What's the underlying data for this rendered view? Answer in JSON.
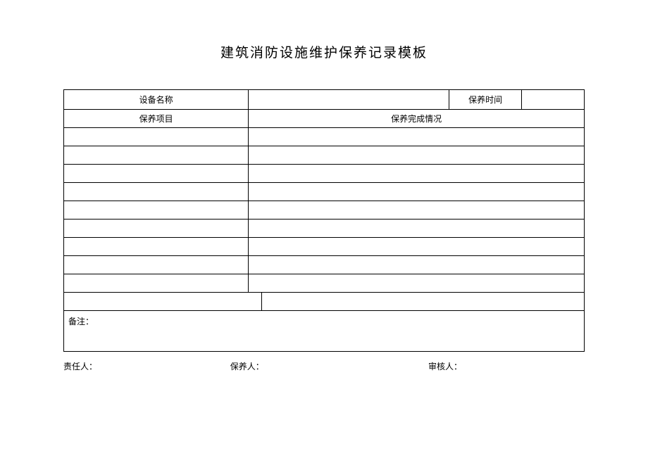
{
  "title": "建筑消防设施维护保养记录模板",
  "headers": {
    "equipment_name": "设备名称",
    "maintenance_time": "保养时间",
    "maintenance_item": "保养项目",
    "completion_status": "保养完成情况"
  },
  "notes_label": "备注：",
  "signatures": {
    "responsible": "责任人：",
    "maintainer": "保养人：",
    "reviewer": "审核人："
  }
}
